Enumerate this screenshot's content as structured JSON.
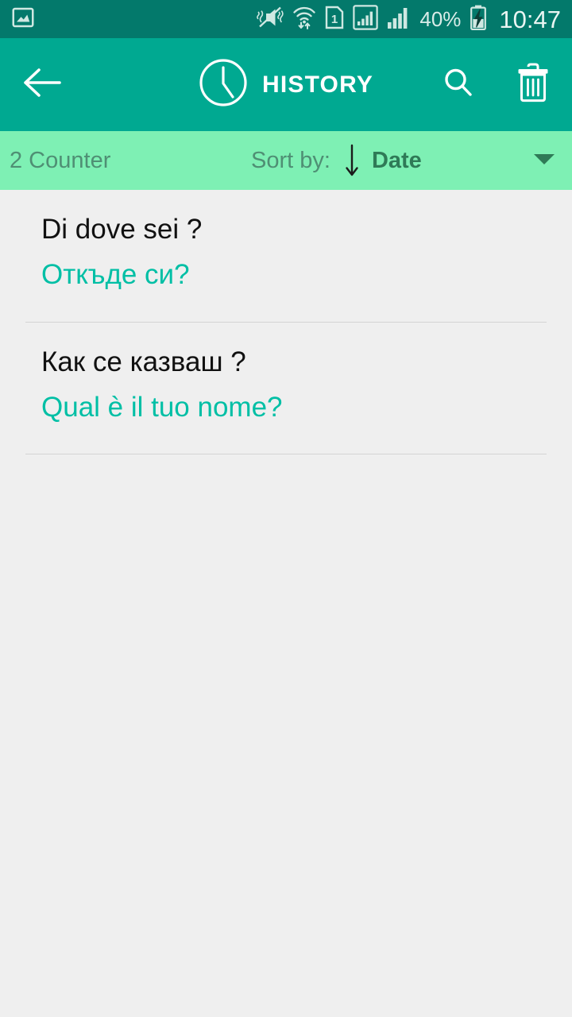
{
  "status_bar": {
    "icons": [
      "image-frame-icon",
      "mute-vibrate-icon",
      "wifi-transfer-icon",
      "sim-one-icon",
      "signal-boxed-icon",
      "signal-bars-icon"
    ],
    "sim_label": "1",
    "battery_percent": "40%",
    "battery_state": "charging",
    "time": "10:47",
    "background_color": "#03796b"
  },
  "app_bar": {
    "back_icon": "arrow-left-icon",
    "title_icon": "clock-icon",
    "title": "HISTORY",
    "search_icon": "search-icon",
    "delete_icon": "trash-icon",
    "background_color": "#00a991"
  },
  "sort_bar": {
    "counter": "2 Counter",
    "sort_label": "Sort by:",
    "direction_icon": "arrow-down-icon",
    "sort_value": "Date",
    "dropdown_icon": "caret-down-icon",
    "background_color": "#7ef0b4"
  },
  "history": {
    "items": [
      {
        "source": "Di dove sei ?",
        "target": "Откъде си?"
      },
      {
        "source": "Как се казваш ?",
        "target": "Qual è il tuo nome?"
      }
    ],
    "source_color": "#111111",
    "target_color": "#00bfa5"
  }
}
